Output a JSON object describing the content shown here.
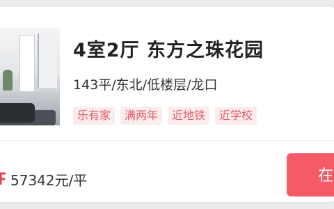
{
  "listing": {
    "title": "4室2厅 东方之珠花园",
    "details": "143平/东北/低楼层/龙口",
    "tags": [
      "乐有家",
      "满两年",
      "近地铁",
      "近学校"
    ],
    "unit_price": "57342元/平",
    "action_label": "在线"
  },
  "colors": {
    "accent": "#f55a67",
    "tag_text": "#e35d6a",
    "tag_bg": "#fdeced"
  }
}
